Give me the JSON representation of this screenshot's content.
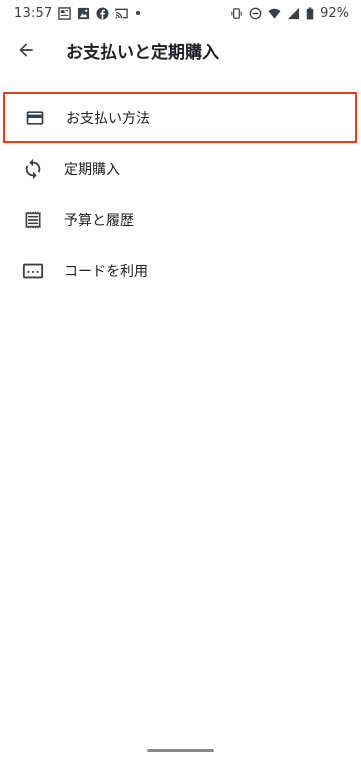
{
  "status_bar": {
    "time": "13:57",
    "battery": "92%",
    "left_icons": [
      "news-icon",
      "photo-icon",
      "facebook-icon",
      "cast-icon",
      "notification-dot"
    ],
    "right_icons": [
      "vibrate-icon",
      "do-not-disturb-icon",
      "wifi-icon",
      "signal-icon",
      "battery-icon"
    ]
  },
  "app_bar": {
    "back_icon": "arrow-back-icon",
    "title": "お支払いと定期購入"
  },
  "menu": {
    "items": [
      {
        "icon": "credit-card-icon",
        "label": "お支払い方法",
        "highlighted": true
      },
      {
        "icon": "sync-icon",
        "label": "定期購入",
        "highlighted": false
      },
      {
        "icon": "receipt-icon",
        "label": "予算と履歴",
        "highlighted": false
      },
      {
        "icon": "redeem-code-icon",
        "label": "コードを利用",
        "highlighted": false
      }
    ]
  },
  "colors": {
    "highlight_border": "#e0401f",
    "text": "#202124",
    "icon": "#3c4043"
  }
}
